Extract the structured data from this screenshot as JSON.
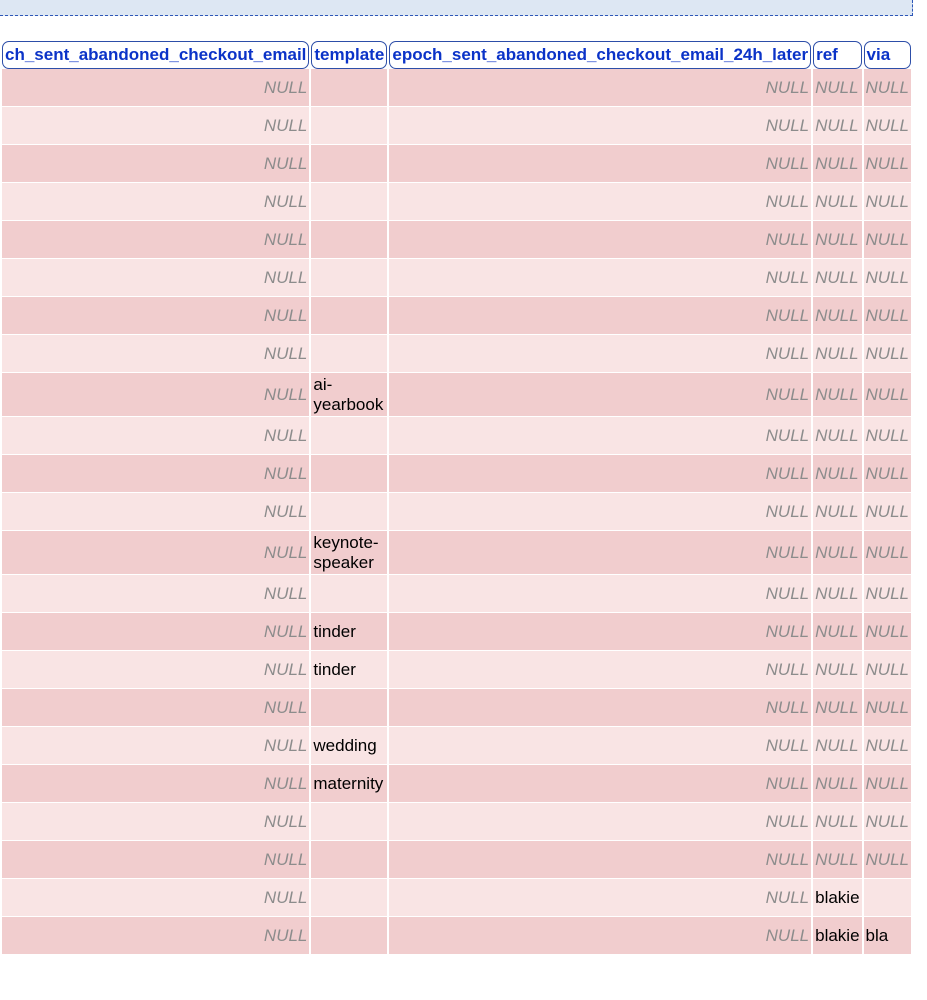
{
  "table": {
    "columns": [
      "ch_sent_abandoned_checkout_email",
      "template",
      "epoch_sent_abandoned_checkout_email_24h_later",
      "ref",
      "via"
    ],
    "null_text": "NULL",
    "rows": [
      {
        "sent_email": "NULL",
        "template": "",
        "sent_email_24h": "NULL",
        "ref": "NULL",
        "via": "NULL"
      },
      {
        "sent_email": "NULL",
        "template": "",
        "sent_email_24h": "NULL",
        "ref": "NULL",
        "via": "NULL"
      },
      {
        "sent_email": "NULL",
        "template": "",
        "sent_email_24h": "NULL",
        "ref": "NULL",
        "via": "NULL"
      },
      {
        "sent_email": "NULL",
        "template": "",
        "sent_email_24h": "NULL",
        "ref": "NULL",
        "via": "NULL"
      },
      {
        "sent_email": "NULL",
        "template": "",
        "sent_email_24h": "NULL",
        "ref": "NULL",
        "via": "NULL"
      },
      {
        "sent_email": "NULL",
        "template": "",
        "sent_email_24h": "NULL",
        "ref": "NULL",
        "via": "NULL"
      },
      {
        "sent_email": "NULL",
        "template": "",
        "sent_email_24h": "NULL",
        "ref": "NULL",
        "via": "NULL"
      },
      {
        "sent_email": "NULL",
        "template": "",
        "sent_email_24h": "NULL",
        "ref": "NULL",
        "via": "NULL"
      },
      {
        "sent_email": "NULL",
        "template": "ai-yearbook",
        "sent_email_24h": "NULL",
        "ref": "NULL",
        "via": "NULL"
      },
      {
        "sent_email": "NULL",
        "template": "",
        "sent_email_24h": "NULL",
        "ref": "NULL",
        "via": "NULL"
      },
      {
        "sent_email": "NULL",
        "template": "",
        "sent_email_24h": "NULL",
        "ref": "NULL",
        "via": "NULL"
      },
      {
        "sent_email": "NULL",
        "template": "",
        "sent_email_24h": "NULL",
        "ref": "NULL",
        "via": "NULL"
      },
      {
        "sent_email": "NULL",
        "template": "keynote-speaker",
        "sent_email_24h": "NULL",
        "ref": "NULL",
        "via": "NULL"
      },
      {
        "sent_email": "NULL",
        "template": "",
        "sent_email_24h": "NULL",
        "ref": "NULL",
        "via": "NULL"
      },
      {
        "sent_email": "NULL",
        "template": "tinder",
        "sent_email_24h": "NULL",
        "ref": "NULL",
        "via": "NULL"
      },
      {
        "sent_email": "NULL",
        "template": "tinder",
        "sent_email_24h": "NULL",
        "ref": "NULL",
        "via": "NULL"
      },
      {
        "sent_email": "NULL",
        "template": "",
        "sent_email_24h": "NULL",
        "ref": "NULL",
        "via": "NULL"
      },
      {
        "sent_email": "NULL",
        "template": "wedding",
        "sent_email_24h": "NULL",
        "ref": "NULL",
        "via": "NULL"
      },
      {
        "sent_email": "NULL",
        "template": "maternity",
        "sent_email_24h": "NULL",
        "ref": "NULL",
        "via": "NULL"
      },
      {
        "sent_email": "NULL",
        "template": "",
        "sent_email_24h": "NULL",
        "ref": "NULL",
        "via": "NULL"
      },
      {
        "sent_email": "NULL",
        "template": "",
        "sent_email_24h": "NULL",
        "ref": "NULL",
        "via": "NULL"
      },
      {
        "sent_email": "NULL",
        "template": "",
        "sent_email_24h": "NULL",
        "ref": "blakie",
        "via": ""
      },
      {
        "sent_email": "NULL",
        "template": "",
        "sent_email_24h": "NULL",
        "ref": "blakie",
        "via": "bla"
      }
    ]
  },
  "colors": {
    "header_text": "#0b33c8",
    "header_border": "#2d4ea8",
    "row_odd": "#f1cdce",
    "row_even": "#f9e4e4",
    "null_text": "#8c8c8c",
    "top_panel": "#dde7f3"
  }
}
